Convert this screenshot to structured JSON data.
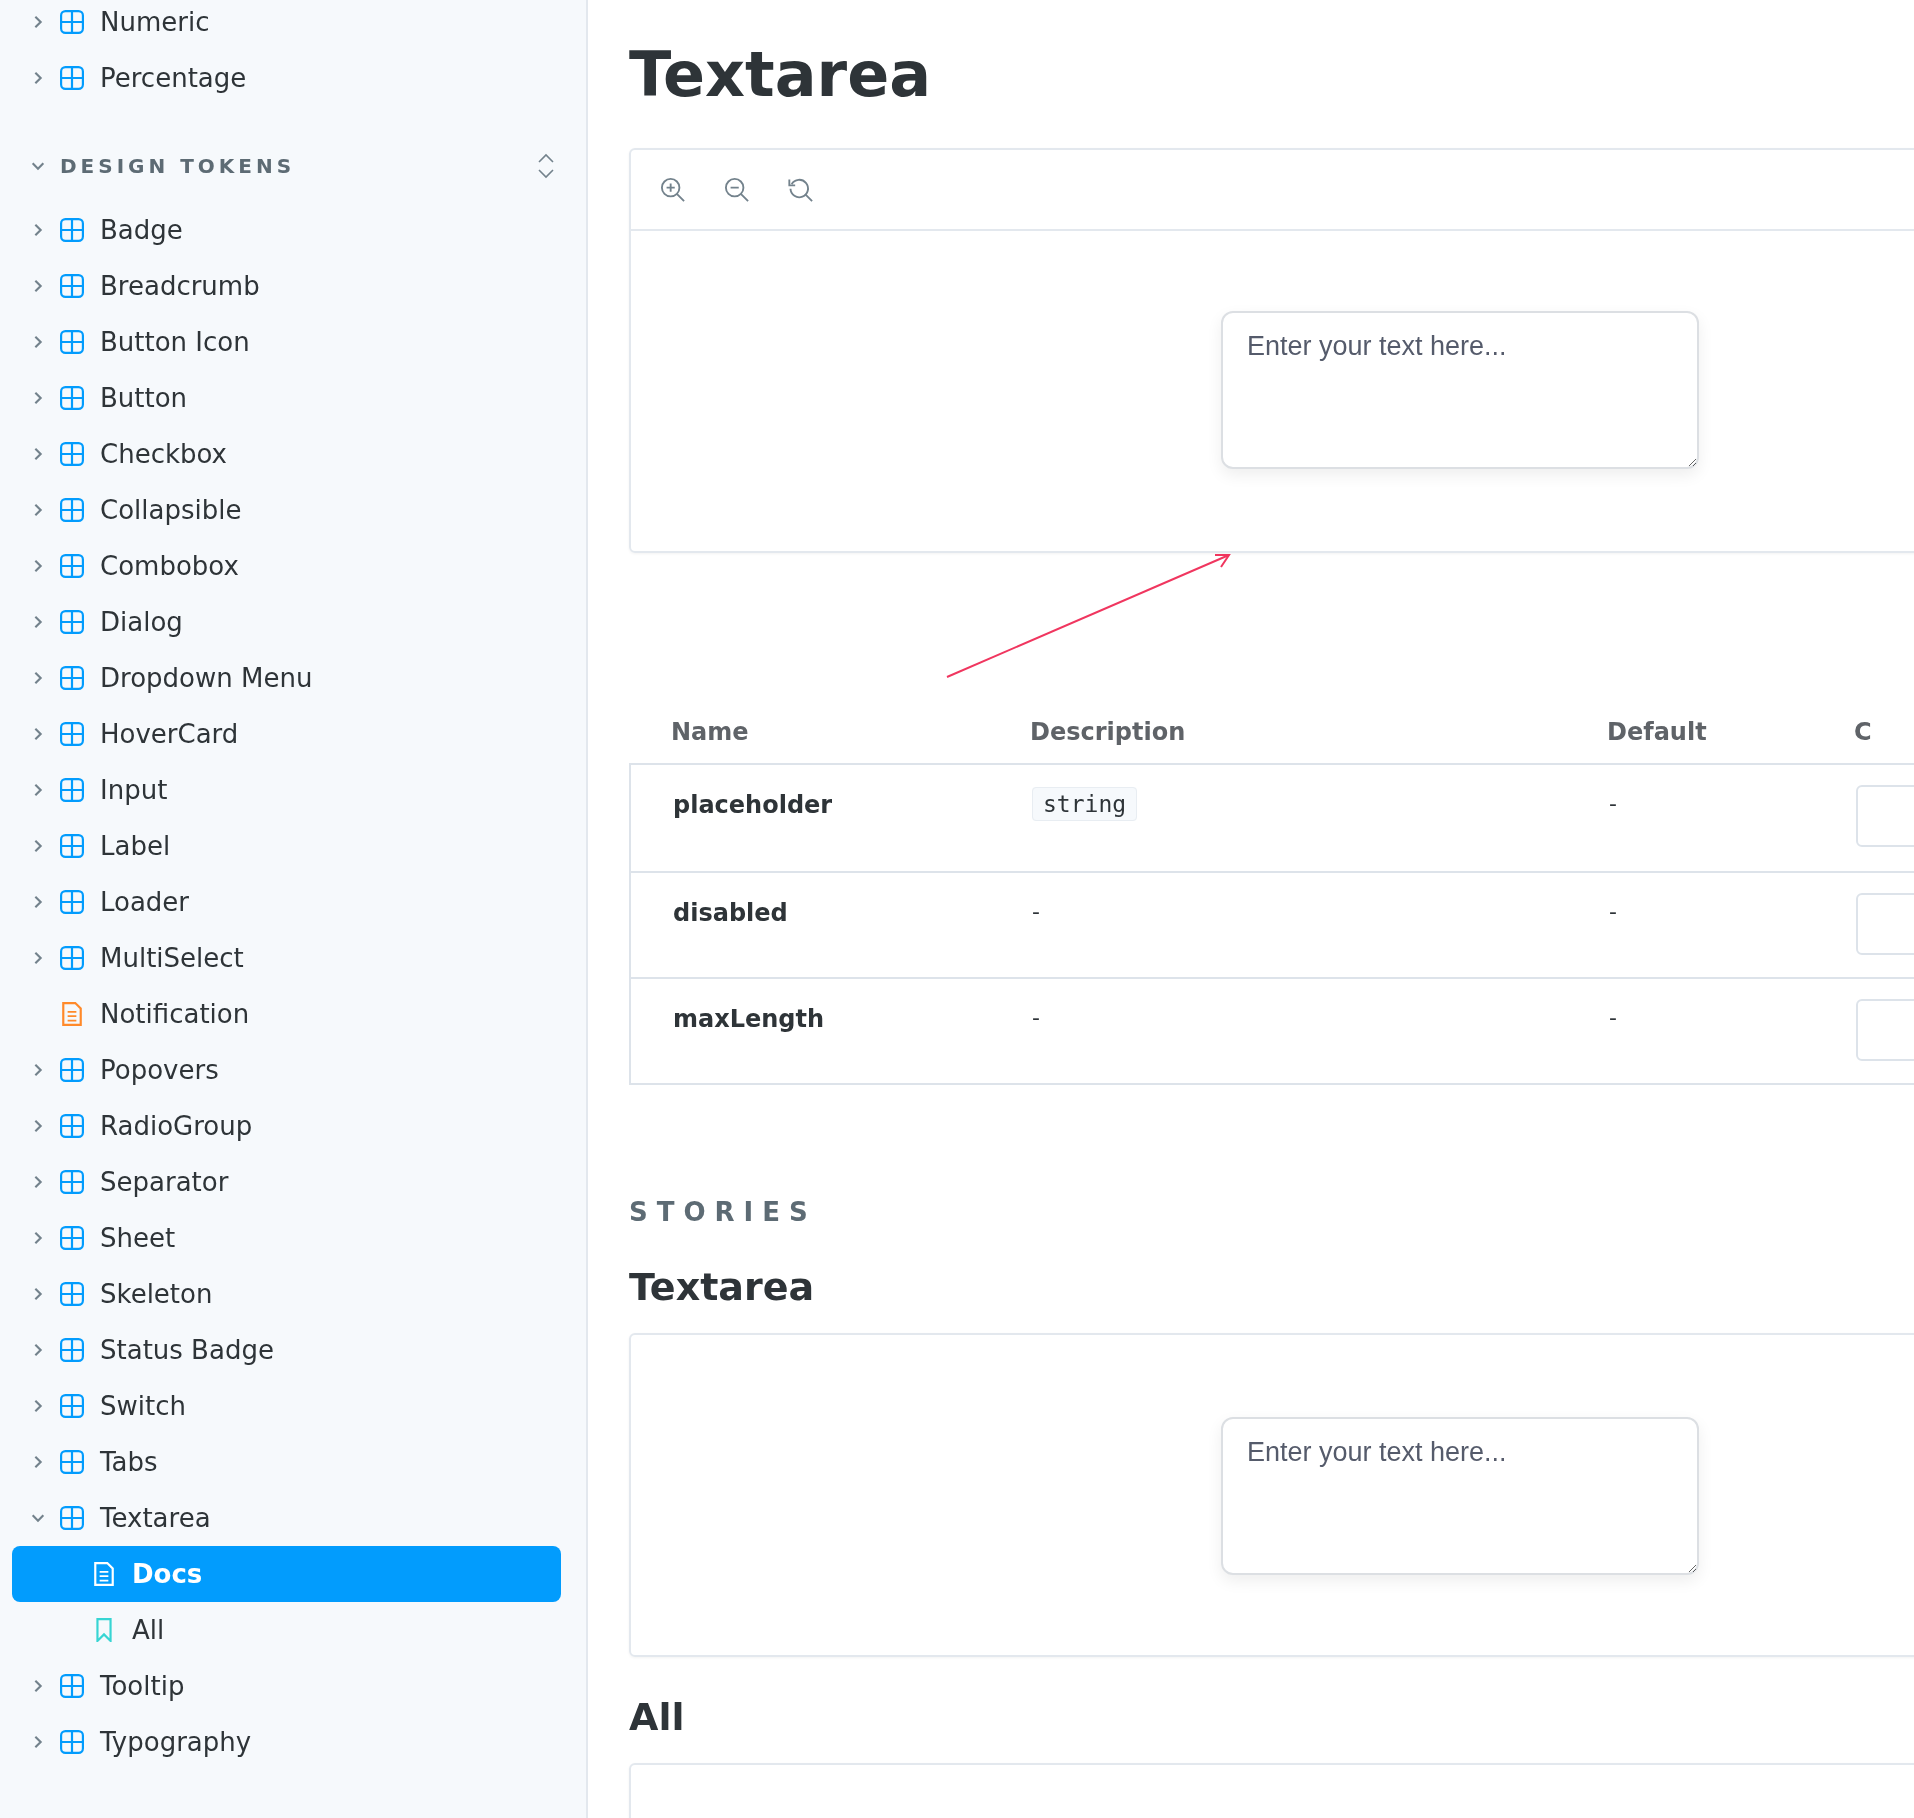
{
  "sidebar": {
    "top_items": [
      {
        "label": "Numeric",
        "kind": "component",
        "expanded": false
      },
      {
        "label": "Percentage",
        "kind": "component",
        "expanded": false
      }
    ],
    "section": {
      "title": "DESIGN TOKENS",
      "expanded": true
    },
    "items": [
      {
        "label": "Badge",
        "kind": "component",
        "expanded": false
      },
      {
        "label": "Breadcrumb",
        "kind": "component",
        "expanded": false
      },
      {
        "label": "Button Icon",
        "kind": "component",
        "expanded": false
      },
      {
        "label": "Button",
        "kind": "component",
        "expanded": false
      },
      {
        "label": "Checkbox",
        "kind": "component",
        "expanded": false
      },
      {
        "label": "Collapsible",
        "kind": "component",
        "expanded": false
      },
      {
        "label": "Combobox",
        "kind": "component",
        "expanded": false
      },
      {
        "label": "Dialog",
        "kind": "component",
        "expanded": false
      },
      {
        "label": "Dropdown Menu",
        "kind": "component",
        "expanded": false
      },
      {
        "label": "HoverCard",
        "kind": "component",
        "expanded": false
      },
      {
        "label": "Input",
        "kind": "component",
        "expanded": false
      },
      {
        "label": "Label",
        "kind": "component",
        "expanded": false
      },
      {
        "label": "Loader",
        "kind": "component",
        "expanded": false
      },
      {
        "label": "MultiSelect",
        "kind": "component",
        "expanded": false
      },
      {
        "label": "Notification",
        "kind": "document"
      },
      {
        "label": "Popovers",
        "kind": "component",
        "expanded": false
      },
      {
        "label": "RadioGroup",
        "kind": "component",
        "expanded": false
      },
      {
        "label": "Separator",
        "kind": "component",
        "expanded": false
      },
      {
        "label": "Sheet",
        "kind": "component",
        "expanded": false
      },
      {
        "label": "Skeleton",
        "kind": "component",
        "expanded": false
      },
      {
        "label": "Status Badge",
        "kind": "component",
        "expanded": false
      },
      {
        "label": "Switch",
        "kind": "component",
        "expanded": false
      },
      {
        "label": "Tabs",
        "kind": "component",
        "expanded": false
      },
      {
        "label": "Textarea",
        "kind": "component",
        "expanded": true,
        "children": [
          {
            "label": "Docs",
            "kind": "docs",
            "selected": true
          },
          {
            "label": "All",
            "kind": "story",
            "selected": false
          }
        ]
      },
      {
        "label": "Tooltip",
        "kind": "component",
        "expanded": false
      },
      {
        "label": "Typography",
        "kind": "component",
        "expanded": false
      }
    ]
  },
  "main": {
    "title": "Textarea",
    "preview": {
      "placeholder": "Enter your text here..."
    },
    "table": {
      "columns": [
        "Name",
        "Description",
        "Default",
        "C"
      ],
      "rows": [
        {
          "name": "placeholder",
          "description": {
            "kind": "code",
            "text": "string"
          },
          "default": "-"
        },
        {
          "name": "disabled",
          "description": {
            "kind": "plain",
            "text": "-"
          },
          "default": "-"
        },
        {
          "name": "maxLength",
          "description": {
            "kind": "plain",
            "text": "-"
          },
          "default": "-"
        }
      ]
    },
    "stories_label": "STORIES",
    "stories": [
      {
        "title": "Textarea",
        "placeholder": "Enter your text here..."
      },
      {
        "title": "All"
      }
    ]
  }
}
